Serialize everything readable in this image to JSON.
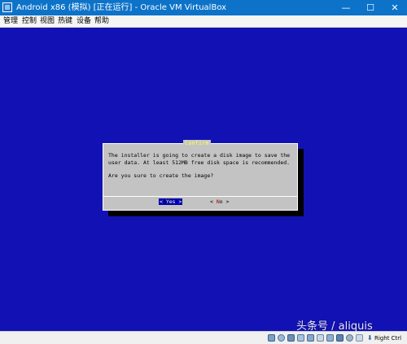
{
  "window": {
    "title": "Android x86 (模拟) [正在运行] - Oracle VM VirtualBox",
    "controls": {
      "minimize": "—",
      "maximize": "☐",
      "close": "✕"
    }
  },
  "menubar": {
    "items": [
      "管理",
      "控制",
      "视图",
      "热键",
      "设备",
      "帮助"
    ]
  },
  "dialog": {
    "title": "Confirm",
    "message_lines": [
      "The installer is going to create a disk image to save the",
      "user data. At least 512MB free disk space is recommended."
    ],
    "question": "Are you sure to create the image?",
    "yes_button": {
      "left": "< ",
      "hotkey": "Y",
      "rest": "es",
      "right": " >"
    },
    "no_button": {
      "left": "< ",
      "hotkey": "N",
      "rest": "o",
      "right": "  >"
    }
  },
  "statusbar": {
    "host_key": "Right Ctrl",
    "icons": [
      "hard-disk-icon",
      "optical-drive-icon",
      "audio-icon",
      "network-icon",
      "usb-icon",
      "shared-folders-icon",
      "display-icon",
      "video-capture-icon",
      "mouse-integration-icon",
      "keyboard-icon"
    ]
  },
  "watermark": "头条号 / aliquis",
  "colors": {
    "titlebar": "#0d73c9",
    "vm_background": "#1212b4",
    "dialog_background": "#c3c3c3",
    "dialog_title": "#ffff55",
    "selected_button": "#0000aa",
    "no_hotkey": "#aa0000"
  }
}
